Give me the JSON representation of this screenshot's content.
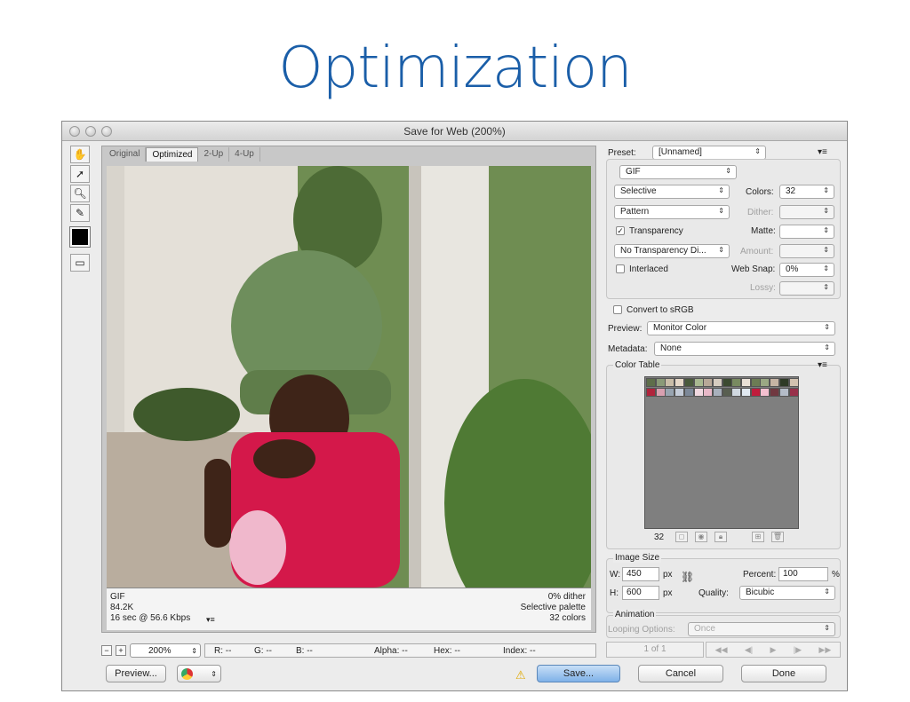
{
  "slide": {
    "title": "Optimization"
  },
  "window": {
    "title": "Save for Web (200%)"
  },
  "tabs": [
    "Original",
    "Optimized",
    "2-Up",
    "4-Up"
  ],
  "image_info": {
    "format": "GIF",
    "size": "84.2K",
    "speed": "16 sec @ 56.6 Kbps",
    "dither": "0% dither",
    "palette": "Selective palette",
    "colors": "32 colors"
  },
  "status": {
    "zoom": "200%",
    "r": "R: --",
    "g": "G: --",
    "b": "B: --",
    "alpha": "Alpha: --",
    "hex": "Hex: --",
    "index": "Index: --"
  },
  "buttons": {
    "preview": "Preview...",
    "save": "Save...",
    "cancel": "Cancel",
    "done": "Done"
  },
  "settings": {
    "preset_label": "Preset:",
    "preset_value": "[Unnamed]",
    "format": "GIF",
    "reduction": "Selective",
    "dither_algo": "Pattern",
    "transparency": "Transparency",
    "transparency_dither": "No Transparency Di...",
    "interlaced": "Interlaced",
    "colors_label": "Colors:",
    "colors_value": "32",
    "dither_label": "Dither:",
    "matte_label": "Matte:",
    "amount_label": "Amount:",
    "websnap_label": "Web Snap:",
    "websnap_value": "0%",
    "lossy_label": "Lossy:",
    "convert_srgb": "Convert to sRGB",
    "preview_label": "Preview:",
    "preview_value": "Monitor Color",
    "metadata_label": "Metadata:",
    "metadata_value": "None"
  },
  "color_table": {
    "title": "Color Table",
    "count": "32",
    "colors": [
      "#5e6e4a",
      "#8a9a78",
      "#c9bda8",
      "#e6d8c8",
      "#4a5a3c",
      "#a8b890",
      "#b8a898",
      "#d6ccc0",
      "#3c4a30",
      "#788a60",
      "#e8e0d6",
      "#6c7c54",
      "#9aa884",
      "#c6b4a4",
      "#2e3a26",
      "#d2c2b0",
      "#b0243c",
      "#d8a0b0",
      "#98a4b0",
      "#c4ccd8",
      "#7c8898",
      "#f0d8e0",
      "#e8b8c8",
      "#a8b0bc",
      "#585e50",
      "#d0d8e0",
      "#e0e8f0",
      "#c01c3c",
      "#f4c0d0",
      "#703840",
      "#b4bcc8",
      "#98304a"
    ],
    "icon_names": [
      "map-to-web-icon",
      "web-shift-icon",
      "lock-color-icon",
      "new-color-icon",
      "delete-color-icon"
    ]
  },
  "image_size": {
    "title": "Image Size",
    "w_label": "W:",
    "w_value": "450",
    "h_label": "H:",
    "h_value": "600",
    "unit": "px",
    "percent_label": "Percent:",
    "percent_value": "100",
    "percent_unit": "%",
    "quality_label": "Quality:",
    "quality_value": "Bicubic"
  },
  "animation": {
    "title": "Animation",
    "looping_label": "Looping Options:",
    "looping_value": "Once",
    "frame": "1 of 1"
  }
}
